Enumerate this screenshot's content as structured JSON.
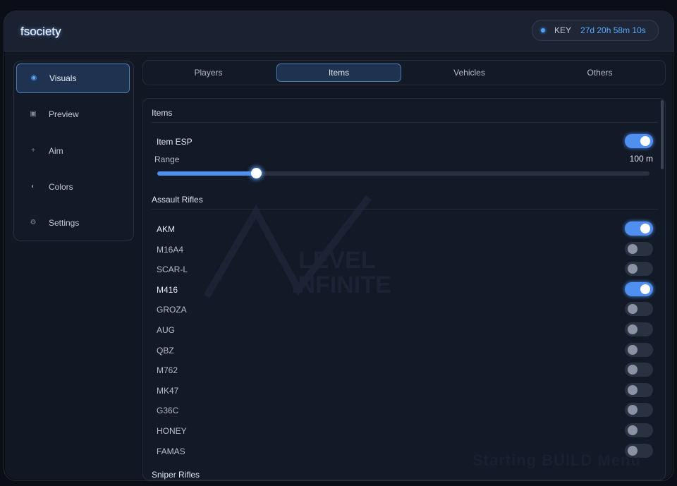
{
  "app": {
    "title": "fsociety"
  },
  "key": {
    "label": "KEY",
    "timer": "27d 20h 58m 10s"
  },
  "sidebar": {
    "items": [
      {
        "label": "Visuals",
        "icon": "radio-dot-icon",
        "active": true
      },
      {
        "label": "Preview",
        "icon": "square-icon",
        "active": false
      },
      {
        "label": "Aim",
        "icon": "plus-icon",
        "active": false
      },
      {
        "label": "Colors",
        "icon": "half-circle-icon",
        "active": false
      },
      {
        "label": "Settings",
        "icon": "gear-icon",
        "active": false
      }
    ]
  },
  "tabs": [
    {
      "label": "Players",
      "active": false
    },
    {
      "label": "Items",
      "active": true
    },
    {
      "label": "Vehicles",
      "active": false
    },
    {
      "label": "Others",
      "active": false
    }
  ],
  "items_section": {
    "title": "Items",
    "item_esp": {
      "label": "Item ESP",
      "enabled": true
    },
    "range": {
      "label": "Range",
      "value_text": "100 m",
      "fraction": 0.2
    }
  },
  "assault_rifles": {
    "title": "Assault Rifles",
    "items": [
      {
        "label": "AKM",
        "enabled": true
      },
      {
        "label": "M16A4",
        "enabled": false
      },
      {
        "label": "SCAR-L",
        "enabled": false
      },
      {
        "label": "M416",
        "enabled": true
      },
      {
        "label": "GROZA",
        "enabled": false
      },
      {
        "label": "AUG",
        "enabled": false
      },
      {
        "label": "QBZ",
        "enabled": false
      },
      {
        "label": "M762",
        "enabled": false
      },
      {
        "label": "MK47",
        "enabled": false
      },
      {
        "label": "G36C",
        "enabled": false
      },
      {
        "label": "HONEY",
        "enabled": false
      },
      {
        "label": "FAMAS",
        "enabled": false
      }
    ]
  },
  "sniper_rifles": {
    "title": "Sniper Rifles"
  },
  "watermark": {
    "text_line1": "LEVEL",
    "text_line2": "INFINITE"
  },
  "background_text": "Starting BUILD Menu",
  "colors": {
    "accent": "#4f8ff0",
    "timer": "#5aa8ff",
    "background": "#111723"
  }
}
